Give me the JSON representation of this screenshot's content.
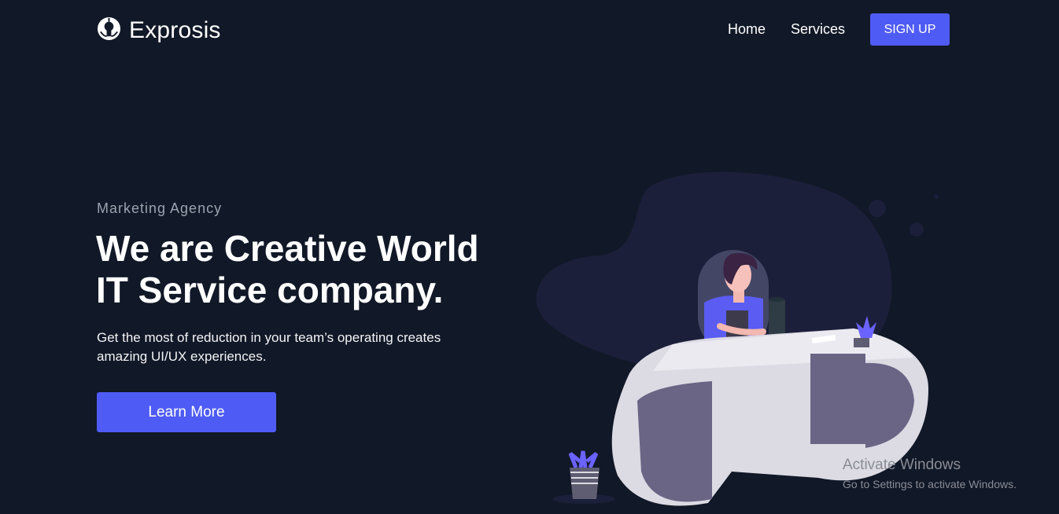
{
  "brand": {
    "name": "Exprosis",
    "logo_icon": "bulb-logo-icon"
  },
  "nav": {
    "items": [
      "Home",
      "Services"
    ],
    "signup_label": "SIGN UP"
  },
  "hero": {
    "eyebrow": "Marketing Agency",
    "title_line1": "We are Creative World",
    "title_line2": "IT Service company.",
    "description": "Get the most of reduction in your team’s operating creates amazing UI/UX experiences.",
    "cta_label": "Learn More"
  },
  "watermark": {
    "title": "Activate Windows",
    "subtitle": "Go to Settings to activate Windows."
  },
  "colors": {
    "background": "#111827",
    "accent": "#4f5bf5",
    "blob": "#1c1f3a"
  }
}
